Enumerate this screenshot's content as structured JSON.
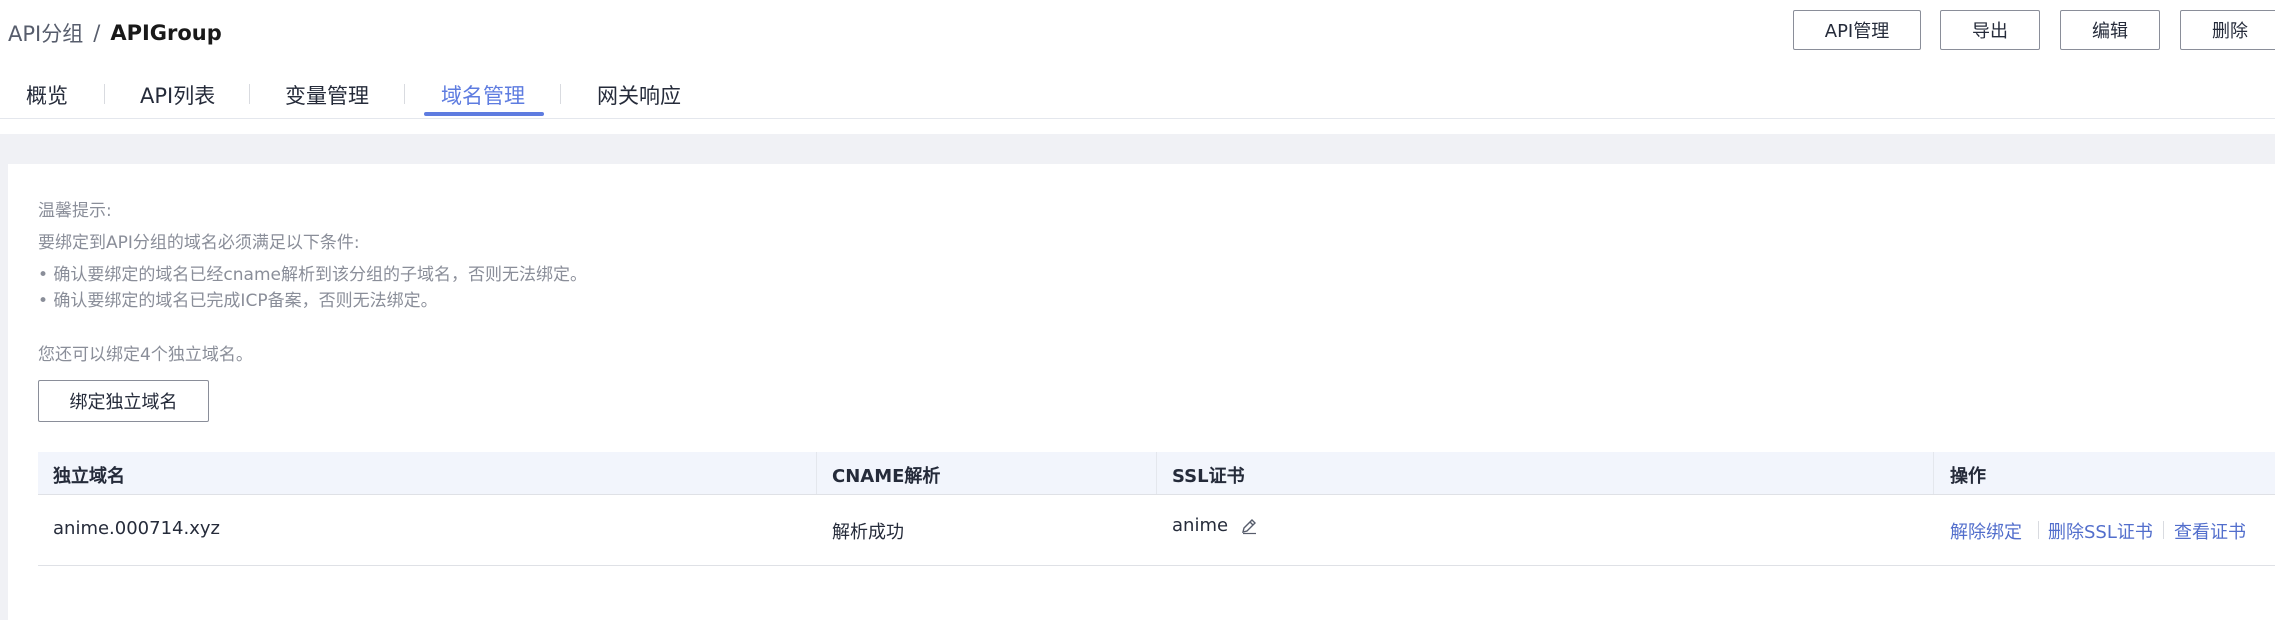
{
  "breadcrumb": {
    "parent": "API分组",
    "separator": "/",
    "current": "APIGroup"
  },
  "actions": {
    "api_manage": "API管理",
    "export": "导出",
    "edit": "编辑",
    "delete": "删除"
  },
  "tabs": [
    {
      "label": "概览"
    },
    {
      "label": "API列表"
    },
    {
      "label": "变量管理"
    },
    {
      "label": "域名管理",
      "active": true
    },
    {
      "label": "网关响应"
    }
  ],
  "tips": {
    "title": "温馨提示:",
    "subtitle": "要绑定到API分组的域名必须满足以下条件:",
    "item1": "• 确认要绑定的域名已经cname解析到该分组的子域名，否则无法绑定。",
    "item2": "• 确认要绑定的域名已完成ICP备案，否则无法绑定。",
    "remaining": "您还可以绑定4个独立域名。"
  },
  "bind_button": "绑定独立域名",
  "table": {
    "headers": {
      "domain": "独立域名",
      "cname": "CNAME解析",
      "ssl": "SSL证书",
      "ops": "操作"
    },
    "rows": [
      {
        "domain": "anime.000714.xyz",
        "cname": "解析成功",
        "ssl": "anime",
        "ops": [
          "解除绑定",
          "删除SSL证书",
          "查看证书"
        ]
      }
    ]
  },
  "colors": {
    "accent": "#5e7ce0",
    "link": "#526ecc",
    "header_bg": "#f2f5fc",
    "band_bg": "#f0f1f5"
  },
  "icons": {
    "ssl_edit": "pencil-edit-icon"
  }
}
